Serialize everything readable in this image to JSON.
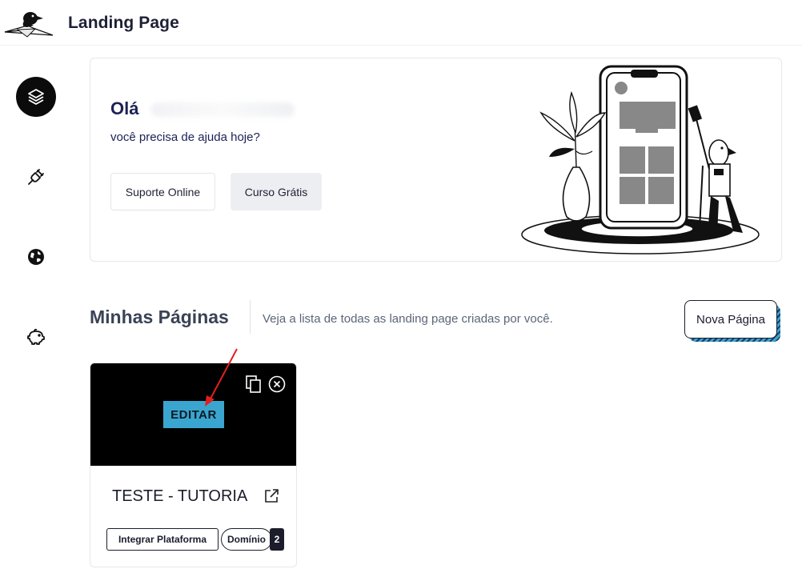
{
  "app": {
    "title": "Landing Page"
  },
  "sidebar": {
    "items": [
      {
        "name": "layers",
        "icon": "layers-icon",
        "active": true
      },
      {
        "name": "integrations",
        "icon": "plug-icon",
        "active": false
      },
      {
        "name": "domains",
        "icon": "globe-icon",
        "active": false
      },
      {
        "name": "finance",
        "icon": "piggy-bank-icon",
        "active": false
      }
    ]
  },
  "welcome": {
    "greeting": "Olá",
    "subtitle": "você precisa de ajuda hoje?",
    "support_label": "Suporte Online",
    "course_label": "Curso Grátis"
  },
  "pages_section": {
    "title": "Minhas Páginas",
    "description": "Veja a lista de todas as landing page criadas por você.",
    "new_page_label": "Nova Página"
  },
  "page_card": {
    "name": "TESTE - TUTORIAL",
    "edit_label": "EDITAR",
    "integrate_label": "Integrar Plataforma",
    "domain_label": "Domínio",
    "domain_count": "2"
  },
  "colors": {
    "accent_blue": "#3aa6cf",
    "dark": "#1b1d2b",
    "title_navy": "#1c2157",
    "annotation_red": "#e02020"
  }
}
